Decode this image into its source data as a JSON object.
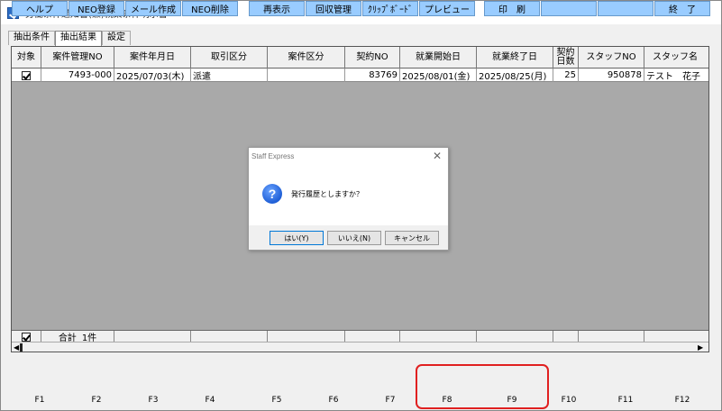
{
  "window": {
    "title": "労働条件通知書(兼)就業条件明示書",
    "controls": {
      "minimize": "—",
      "maximize": "☐",
      "close": "✕"
    }
  },
  "tabs": [
    {
      "label": "抽出条件",
      "active": false
    },
    {
      "label": "抽出結果",
      "active": true
    },
    {
      "label": "設定",
      "active": false
    }
  ],
  "grid": {
    "columns": [
      "対象",
      "案件管理NO",
      "案件年月日",
      "取引区分",
      "案件区分",
      "契約NO",
      "就業開始日",
      "就業終了日",
      "契約日数",
      "スタッフNO",
      "スタッフ名"
    ],
    "rows": [
      {
        "checked": true,
        "case_no": "7493-000",
        "case_date": "2025/07/03(木)",
        "trade_type": "派遣",
        "case_type": "",
        "contract_no": "83769",
        "start_date": "2025/08/01(金)",
        "end_date": "2025/08/25(月)",
        "days": "25",
        "staff_no": "950878",
        "staff_name": "テスト　花子"
      }
    ],
    "footer": {
      "checked": true,
      "total_label": "合計",
      "total_count": "1件"
    }
  },
  "dialog": {
    "title": "Staff Express",
    "message": "発行履歴としますか？",
    "buttons": {
      "yes": "はい(Y)",
      "no": "いいえ(N)",
      "cancel": "キャンセル"
    }
  },
  "function_keys": [
    {
      "label": "ヘルプ",
      "key": "F1"
    },
    {
      "label": "NEO登録",
      "key": "F2"
    },
    {
      "label": "メール作成",
      "key": "F3"
    },
    {
      "label": "NEO削除",
      "key": "F4"
    },
    {
      "label": "再表示",
      "key": "F5"
    },
    {
      "label": "回収管理",
      "key": "F6"
    },
    {
      "label": "ｸﾘｯﾌﾟﾎﾞｰﾄﾞ",
      "key": "F7"
    },
    {
      "label": "プレビュー",
      "key": "F8"
    },
    {
      "label": "印　刷",
      "key": "F9"
    },
    {
      "label": "",
      "key": "F10"
    },
    {
      "label": "",
      "key": "F11"
    },
    {
      "label": "終　了",
      "key": "F12"
    }
  ],
  "colors": {
    "fkey_bg": "#99ccff",
    "highlight": "#e02020",
    "grid_bg": "#a9a9a9"
  }
}
